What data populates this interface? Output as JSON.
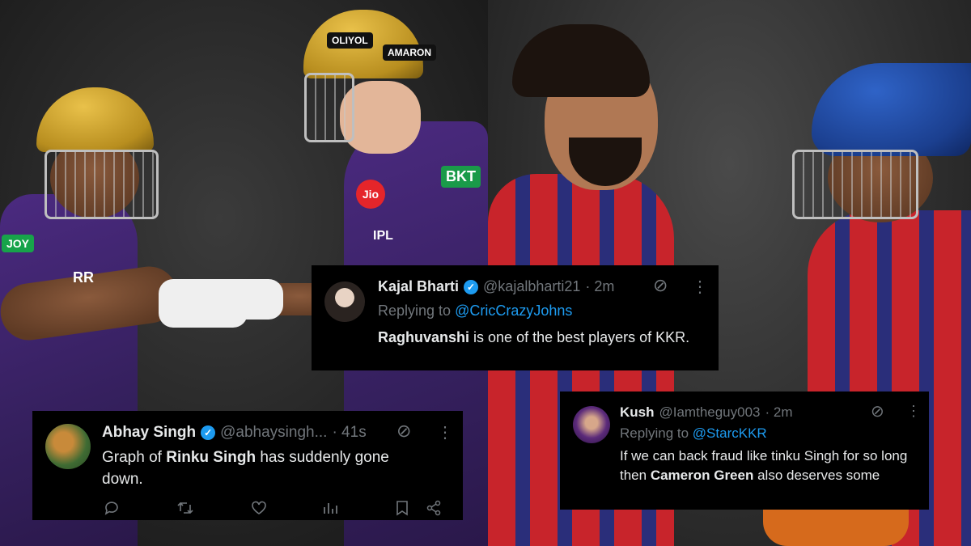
{
  "tweets": {
    "kajal": {
      "name": "Kajal Bharti",
      "handle": "@kajalbharti21",
      "time": "· 2m",
      "replying_label": "Replying to",
      "replying_to": "@CricCrazyJohns",
      "text_bold": "Raghuvanshi",
      "text_rest": " is one of the best players of KKR."
    },
    "abhay": {
      "name": "Abhay Singh",
      "handle": "@abhaysingh...",
      "time": "· 41s",
      "text_pre": "Graph of ",
      "text_bold": "Rinku Singh",
      "text_post": " has suddenly gone down."
    },
    "kush": {
      "name": "Kush",
      "handle": "@Iamtheguy003",
      "time": "· 2m",
      "replying_label": "Replying to",
      "replying_to": "@StarcKKR",
      "text_pre": "If we can back fraud like tinku Singh for so long then ",
      "text_bold": "Cameron Green",
      "text_post": " also deserves some"
    }
  },
  "sponsors": {
    "oliyol": "OLIYOL",
    "amaron": "AMARON",
    "bkt": "BKT",
    "jio": "Jio",
    "ipl": "IPL",
    "joy": "JOY",
    "rr": "RR"
  },
  "icons": {
    "verified": "✓",
    "grok": "⊘",
    "more": "⋮"
  },
  "colors": {
    "tweet_bg": "#000000",
    "link_blue": "#1d9bf0",
    "muted": "#71767b",
    "kkr_purple": "#3b2468",
    "pbks_red": "#c8242b"
  }
}
